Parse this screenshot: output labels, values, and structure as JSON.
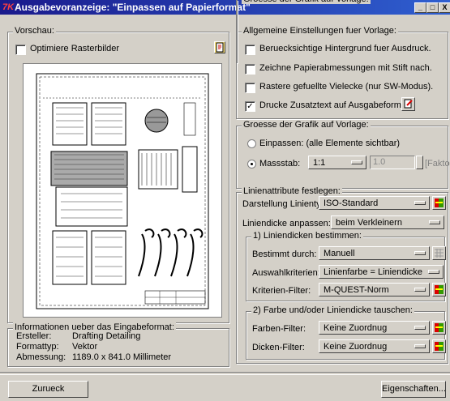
{
  "window": {
    "title": "Ausgabevoranzeige: \"Einpassen auf Papierformat\"",
    "buttons": [
      "_",
      "□",
      "X"
    ]
  },
  "preview": {
    "group_label": "Vorschau:",
    "optimize_label": "Optimiere Rasterbilder",
    "optimize_checked": false
  },
  "info": {
    "group_label": "Informationen ueber das Eingabeformat:",
    "rows": [
      {
        "label": "Ersteller:",
        "value": "Drafting Detailing"
      },
      {
        "label": "Formattyp:",
        "value": "Vektor"
      },
      {
        "label": "Abmessung:",
        "value": "1189.0 x 841.0 Millimeter"
      }
    ]
  },
  "general": {
    "group_label": "Allgemeine Einstellungen fuer Vorlage:",
    "options": [
      {
        "label": "Beruecksichtige Hintergrund fuer Ausdruck.",
        "checked": false
      },
      {
        "label": "Zeichne Papierabmessungen mit Stift nach.",
        "checked": false
      },
      {
        "label": "Rastere gefuellte Vielecke (nur SW-Modus).",
        "checked": false
      },
      {
        "label": "Drucke Zusatztext auf Ausgabeformat.",
        "checked": true
      }
    ]
  },
  "size": {
    "group_label": "Groesse der Grafik auf Vorlage:",
    "fit_label": "Einpassen:  (alle Elemente sichtbar)",
    "scale_label": "Massstab:",
    "scale_value": "1:1",
    "factor_value": "1.0",
    "factor_label": "[Faktor]",
    "selected": "Massstab"
  },
  "lines": {
    "group_label": "Linienattribute festlegen:",
    "type_label": "Darstellung Linientyp:",
    "type_value": "ISO-Standard",
    "width_label": "Liniendicke anpassen:",
    "width_value": "beim Verkleinern",
    "sub1": {
      "group_label": "1) Liniendicken bestimmen:",
      "rows": [
        {
          "label": "Bestimmt durch:",
          "value": "Manuell"
        },
        {
          "label": "Auswahlkriterien:",
          "value": "Linienfarbe = Liniendicke"
        },
        {
          "label": "Kriterien-Filter:",
          "value": "M-QUEST-Norm"
        }
      ]
    },
    "sub2": {
      "group_label": "2) Farbe und/oder Liniendicke tauschen:",
      "rows": [
        {
          "label": "Farben-Filter:",
          "value": "Keine Zuordnug"
        },
        {
          "label": "Dicken-Filter:",
          "value": "Keine Zuordnug"
        }
      ]
    }
  },
  "footer": {
    "back": "Zurueck",
    "properties": "Eigenschaften..."
  }
}
